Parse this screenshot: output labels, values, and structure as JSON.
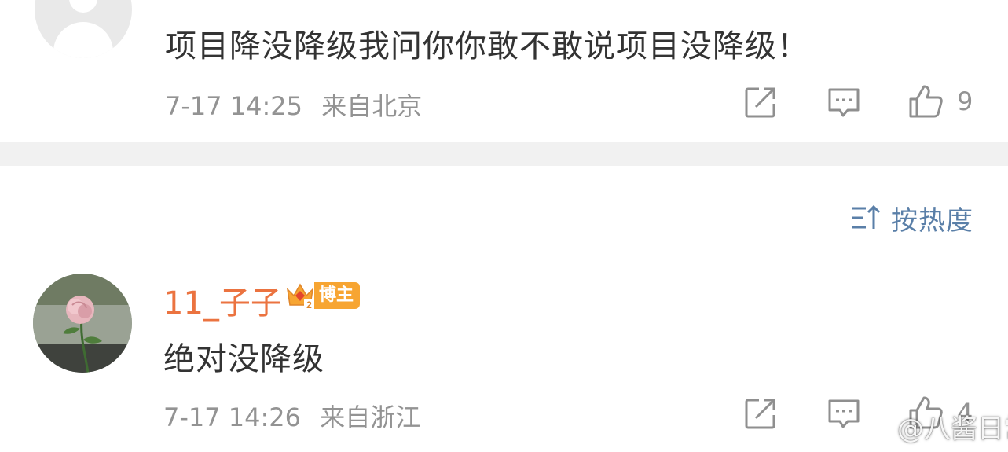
{
  "comment_1": {
    "text": "项目降没降级我问你你敢不敢说项目没降级！",
    "time": "7-17 14:25",
    "location": "来自北京",
    "like_count": "9"
  },
  "sort": {
    "label": "按热度"
  },
  "comment_2": {
    "username": "11_子子",
    "badge": "博主",
    "badge_level": "2",
    "text": "绝对没降级",
    "time": "7-17 14:26",
    "location": "来自浙江",
    "like_count": "4"
  },
  "watermark": {
    "text": "@八酱日常"
  },
  "colors": {
    "username": "#eb7340",
    "meta": "#939393",
    "sort_accent": "#5a7fa8",
    "badge": "#f7a532",
    "divider": "#f1f1f1"
  },
  "icons": {
    "share": "share-icon",
    "comment": "comment-icon",
    "like": "thumbs-up-icon",
    "sort": "sort-icon",
    "crown": "crown-icon",
    "weibo": "weibo-logo-icon"
  }
}
